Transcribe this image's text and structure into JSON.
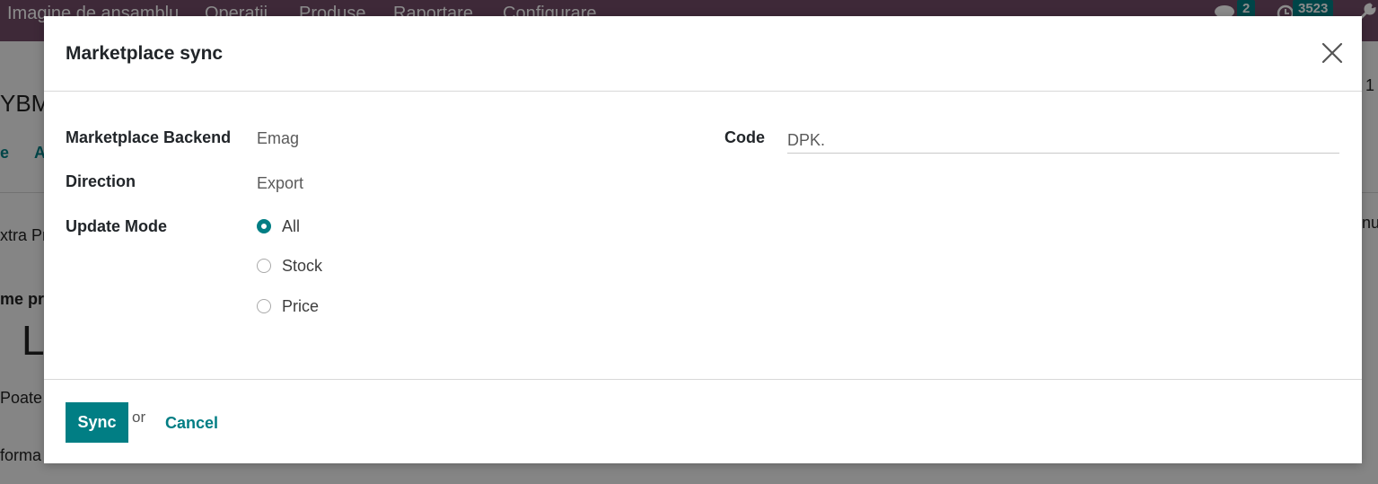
{
  "background": {
    "nav_items": [
      "Imagine de ansamblu",
      "Operații",
      "Produse",
      "Raportare",
      "Configurare"
    ],
    "messages_count": "2",
    "activities_count": "3523",
    "fragments": {
      "record_ref": "YBM",
      "record_counter": "1",
      "tab_extra": "xtra Pr",
      "tab_right": "nu",
      "field_name": "me pro",
      "big_letter": "L",
      "can_be": "Poate",
      "info": "forma",
      "toolbar_e": "e",
      "toolbar_a": "A"
    }
  },
  "dialog": {
    "title": "Marketplace sync",
    "fields": {
      "backend_label": "Marketplace Backend",
      "backend_value": "Emag",
      "direction_label": "Direction",
      "direction_value": "Export",
      "update_mode_label": "Update Mode",
      "code_label": "Code",
      "code_value": "DPK."
    },
    "update_mode_options": [
      {
        "label": "All",
        "checked": true
      },
      {
        "label": "Stock",
        "checked": false
      },
      {
        "label": "Price",
        "checked": false
      }
    ],
    "footer": {
      "sync_label": "Sync",
      "or_text": "or",
      "cancel_label": "Cancel"
    }
  },
  "colors": {
    "navbar": "#714b67",
    "accent": "#017e84"
  }
}
